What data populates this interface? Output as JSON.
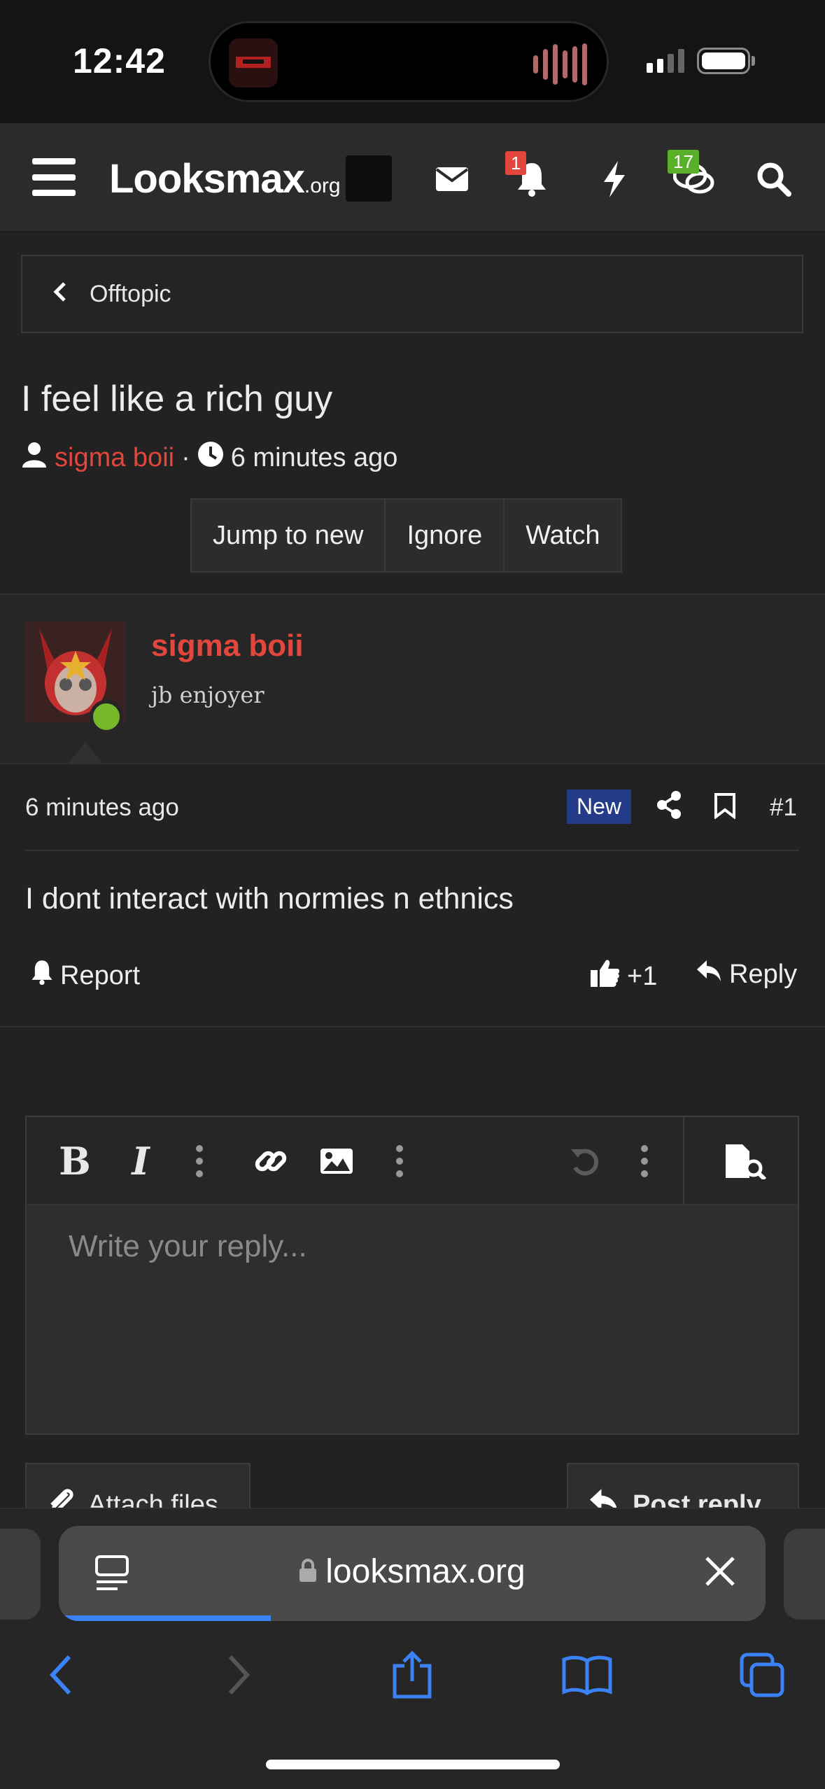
{
  "status_bar": {
    "time": "12:42"
  },
  "header": {
    "logo_main": "Looksmax",
    "logo_suffix": ".org",
    "notifications_count": "1",
    "chat_count": "17",
    "accent_badge_color": "#e2463c",
    "chat_badge_color": "#5bb02a"
  },
  "breadcrumb": {
    "label": "Offtopic"
  },
  "thread": {
    "title": "I feel like a rich guy",
    "author": "sigma boii",
    "separator": "·",
    "time_ago": "6 minutes ago",
    "buttons": [
      "Jump to new",
      "Ignore",
      "Watch"
    ]
  },
  "post": {
    "username": "sigma boii",
    "user_title": "jb enjoyer",
    "time_ago": "6 minutes ago",
    "new_label": "New",
    "number": "#1",
    "body": "I dont interact with normies n ethnics",
    "report_label": "Report",
    "reaction_count": "+1",
    "reply_label": "Reply"
  },
  "editor": {
    "placeholder": "Write your reply...",
    "attach_label": "Attach files",
    "post_reply_label": "Post reply"
  },
  "browser": {
    "url": "looksmax.org",
    "load_progress": 0.3
  }
}
